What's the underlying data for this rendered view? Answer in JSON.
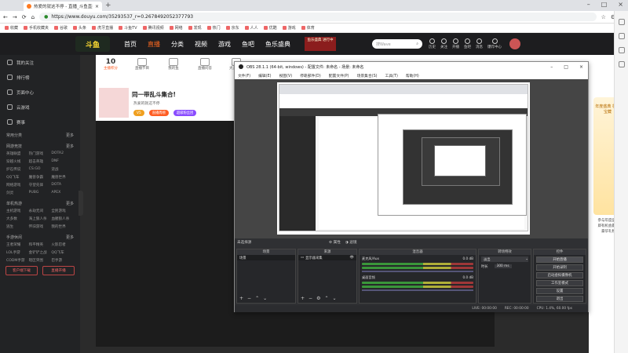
{
  "browser": {
    "tab_title": "热爱的就这不停 - 直播_斗鱼直播",
    "url": "https://www.douyu.com/35293537_r=0.2678492052377793",
    "bookmarks": [
      "收藏",
      "手机收藏夹",
      "谷歌",
      "头条",
      "虎牙直播",
      "斗鱼TV",
      "腾讯视频",
      "网络",
      "发现",
      "热门",
      "京东",
      "人人",
      "优酷",
      "游戏",
      "体育"
    ]
  },
  "site": {
    "logo": "斗鱼",
    "nav": [
      "首页",
      "直播",
      "分类",
      "视频",
      "游戏",
      "鱼吧",
      "鱼乐盛典"
    ],
    "promo": "鱼乐盛典 进行中",
    "search_placeholder": "搜Wave",
    "header_icons": [
      "历史",
      "关注",
      "开播",
      "鱼吧",
      "消息",
      "爆炸中心"
    ],
    "accent": "#ff5d23"
  },
  "sidebar": {
    "items": [
      "我的关注",
      "排行榜",
      "页面中心",
      "云游戏",
      "赛事"
    ],
    "sections": [
      {
        "title": "常用分类",
        "more": "更多",
        "items": []
      },
      {
        "title": "网游竞技",
        "more": "更多",
        "items": [
          "英雄联盟",
          "热门游戏",
          "DOTA2",
          "穿越火线",
          "超击英雄",
          "DNF",
          "炉石传说",
          "CS:GO",
          "逆战",
          "QQ飞车",
          "魔兽争霸",
          "魔兽世界",
          "网络游戏",
          "守望先锋",
          "DOTA",
          "剑灵",
          "PUBG",
          "APEX"
        ]
      },
      {
        "title": "单机热游",
        "more": "更多",
        "items": [
          "主机游戏",
          "永劫无间",
          "全民游戏",
          "大多数",
          "海上狼人杀",
          "血腥狼人杀",
          "逃生",
          "怀旧游戏",
          "我的世界"
        ]
      },
      {
        "title": "手游休闲",
        "more": "更多",
        "items": [
          "王者荣耀",
          "和平精英",
          "火影忍者",
          "LOL手游",
          "金铲铲之战",
          "QQ飞车",
          "CODM手游",
          "暗区突围",
          "巴手游"
        ]
      }
    ],
    "buttons": [
      "客户端下载",
      "直播开播"
    ]
  },
  "room": {
    "stats": [
      {
        "num": "10",
        "label": "主播积分"
      },
      {
        "num": "",
        "label": "直播节目"
      },
      {
        "num": "",
        "label": "我的鱼"
      },
      {
        "num": "",
        "label": "直播问答"
      },
      {
        "num": "",
        "label": "大力金条"
      }
    ],
    "title": "同一带乱斗集合!",
    "subtitle": "英雄 · 网游竞技 · 英雄联盟 · 举报",
    "streamer": "热爱的就这不停",
    "badges": [
      "V5",
      "直播周榜",
      "超级粉丝团"
    ],
    "event_label": "年度盛典 争夺宝藏",
    "event_side": "参与年度盛典 即有机会赢得豪华礼物"
  },
  "obs": {
    "title": "OBS 28.1.1 (64-bit, windows) - 配置文件: 未命名 - 场景: 未命名",
    "menu": [
      "文件(F)",
      "编辑(E)",
      "视图(V)",
      "停靠部件(D)",
      "配置文件(P)",
      "场景集合(S)",
      "工具(T)",
      "帮助(H)"
    ],
    "mid_bar": [
      "未选择源",
      "属性",
      "滤镜"
    ],
    "docks": {
      "scenes": {
        "title": "场景",
        "items": [
          "场景"
        ]
      },
      "sources": {
        "title": "来源",
        "items": [
          "显示器采集"
        ]
      },
      "mixer": {
        "title": "混音器",
        "channels": [
          {
            "name": "麦克风/Aux",
            "db": "0.0 dB"
          },
          {
            "name": "桌面音频",
            "db": "0.0 dB"
          }
        ]
      },
      "transitions": {
        "title": "转场特效",
        "type": "淡出",
        "duration_label": "时长",
        "duration": "300 ms"
      },
      "controls": {
        "title": "控件",
        "buttons": [
          "开始直播",
          "开始录制",
          "启动虚拟摄像机",
          "工作室模式",
          "设置",
          "退出"
        ]
      }
    },
    "status": [
      "LIVE: 00:00:00",
      "REC: 00:00:00",
      "CPU: 1.4%, 60.00 fps"
    ]
  }
}
